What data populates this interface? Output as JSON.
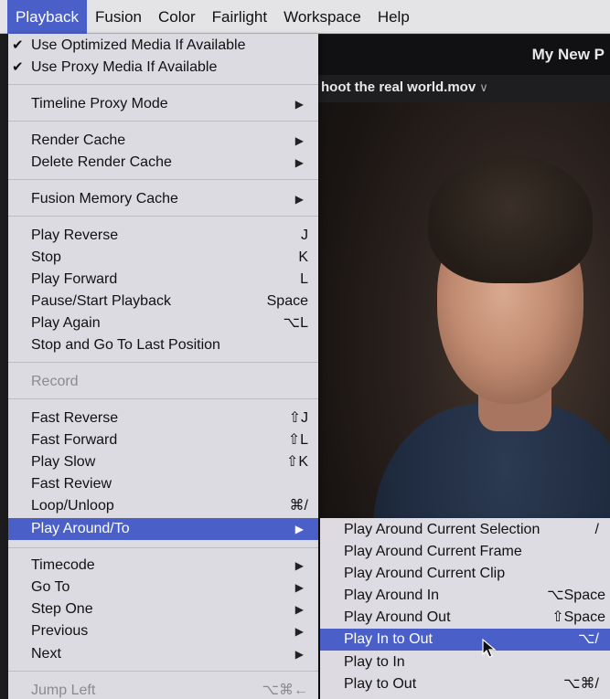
{
  "menubar": {
    "items": [
      "Playback",
      "Fusion",
      "Color",
      "Fairlight",
      "Workspace",
      "Help"
    ]
  },
  "viewer": {
    "project_title": "My New P",
    "clip_name": "hoot the real world.mov",
    "clip_chevron": "∨"
  },
  "playback_menu": {
    "items": [
      {
        "label": "Use Optimized Media If Available",
        "check": "✔"
      },
      {
        "label": "Use Proxy Media If Available",
        "check": "✔"
      },
      {
        "label": "Timeline Proxy Mode",
        "submenu": "▶"
      },
      {
        "label": "Render Cache",
        "submenu": "▶"
      },
      {
        "label": "Delete Render Cache",
        "submenu": "▶"
      },
      {
        "label": "Fusion Memory Cache",
        "submenu": "▶"
      },
      {
        "label": "Play Reverse",
        "shortcut": "J"
      },
      {
        "label": "Stop",
        "shortcut": "K"
      },
      {
        "label": "Play Forward",
        "shortcut": "L"
      },
      {
        "label": "Pause/Start Playback",
        "shortcut": "Space"
      },
      {
        "label": "Play Again",
        "shortcut": "⌥L"
      },
      {
        "label": "Stop and Go To Last Position"
      },
      {
        "label": "Record"
      },
      {
        "label": "Fast Reverse",
        "shortcut": "⇧J"
      },
      {
        "label": "Fast Forward",
        "shortcut": "⇧L"
      },
      {
        "label": "Play Slow",
        "shortcut": "⇧K"
      },
      {
        "label": "Fast Review"
      },
      {
        "label": "Loop/Unloop",
        "shortcut": "⌘/"
      },
      {
        "label": "Play Around/To",
        "submenu": "▶"
      },
      {
        "label": "Timecode",
        "submenu": "▶"
      },
      {
        "label": "Go To",
        "submenu": "▶"
      },
      {
        "label": "Step One",
        "submenu": "▶"
      },
      {
        "label": "Previous",
        "submenu": "▶"
      },
      {
        "label": "Next",
        "submenu": "▶"
      },
      {
        "label": "Jump Left",
        "shortcut": "⌥⌘←"
      }
    ]
  },
  "play_around_submenu": {
    "items": [
      {
        "label": "Play Around Current Selection",
        "shortcut": "/"
      },
      {
        "label": "Play Around Current Frame"
      },
      {
        "label": "Play Around Current Clip"
      },
      {
        "label": "Play Around In",
        "shortcut": "⌥Space"
      },
      {
        "label": "Play Around Out",
        "shortcut": "⇧Space"
      },
      {
        "label": "Play In to Out",
        "shortcut": "⌥/"
      },
      {
        "label": "Play to In"
      },
      {
        "label": "Play to Out",
        "shortcut": "⌥⌘/"
      }
    ]
  },
  "colors": {
    "highlight": "#4a5fc8",
    "menu_bg": "#e4e2e8",
    "disabled_text": "#8a8a8e"
  }
}
